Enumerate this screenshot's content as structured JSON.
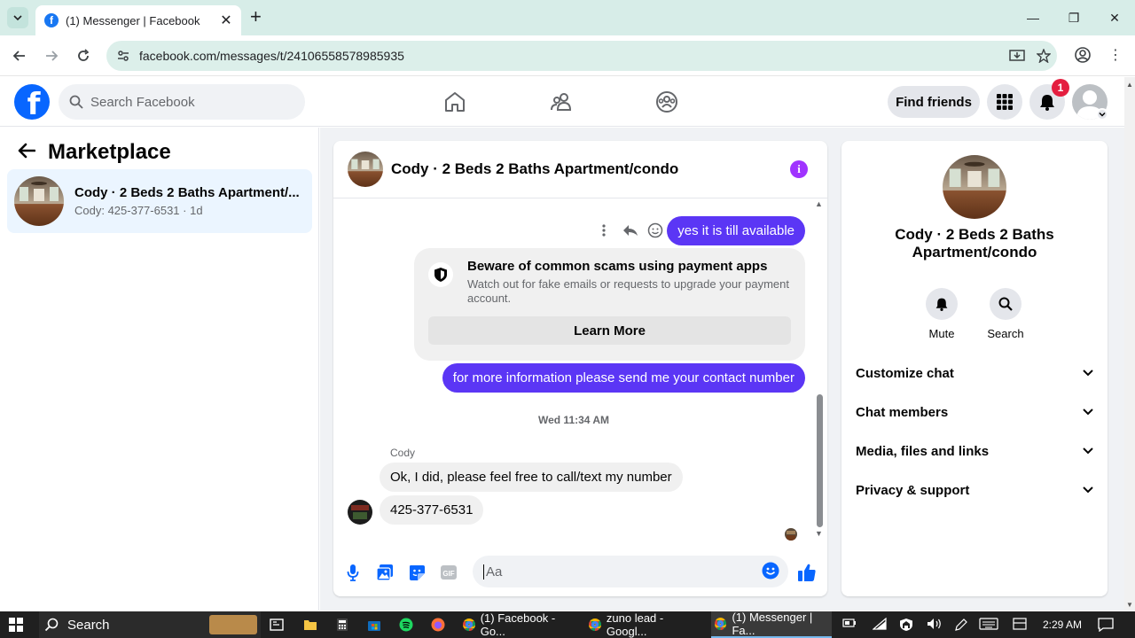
{
  "browser": {
    "tab_title": "(1) Messenger | Facebook",
    "url": "facebook.com/messages/t/24106558578985935"
  },
  "fb": {
    "search_placeholder": "Search Facebook",
    "find_friends": "Find friends",
    "notification_count": "1"
  },
  "left": {
    "title": "Marketplace",
    "conversation": {
      "name": "Cody · 2 Beds 2 Baths Apartment/...",
      "sub": "Cody: 425-377-6531 · 1d"
    }
  },
  "chat": {
    "title": "Cody · 2 Beds 2 Baths Apartment/condo",
    "messages": {
      "out1": "yes it is till available",
      "scam_title": "Beware of common scams using payment apps",
      "scam_desc": "Watch out for fake emails or requests to upgrade your payment account.",
      "learn_more": "Learn More",
      "out2": "for more information please send me your contact number",
      "timestamp": "Wed 11:34 AM",
      "sender": "Cody",
      "in1": "Ok, I did, please feel free to call/text my number",
      "in2": "425-377-6531"
    },
    "composer_placeholder": "Aa"
  },
  "right": {
    "name": "Cody · 2 Beds 2 Baths Apartment/condo",
    "actions": {
      "mute": "Mute",
      "search": "Search"
    },
    "sections": [
      "Customize chat",
      "Chat members",
      "Media, files and links",
      "Privacy & support"
    ]
  },
  "taskbar": {
    "search": "Search",
    "apps": [
      "(1) Facebook - Go...",
      "zuno lead - Googl...",
      "(1) Messenger | Fa..."
    ],
    "time": "2:29 AM"
  },
  "colors": {
    "brand": "#0866ff",
    "outgoing_bubble": "#5b36f5",
    "info_icon": "#a033ff",
    "selected_item": "#ebf5ff"
  }
}
